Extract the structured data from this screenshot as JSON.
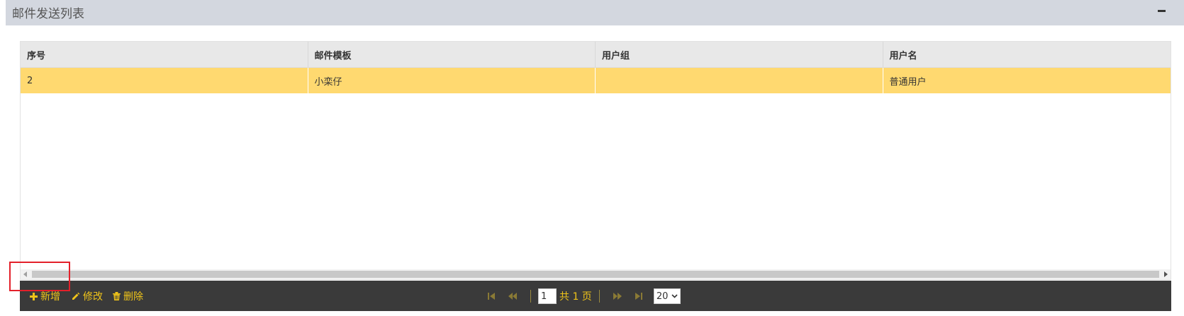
{
  "panel": {
    "title": "邮件发送列表"
  },
  "grid": {
    "columns": [
      "序号",
      "邮件模板",
      "用户组",
      "用户名"
    ],
    "rows": [
      [
        "2",
        "小栾仔",
        "",
        "普通用户"
      ]
    ],
    "selected_row_color": "#ffd970"
  },
  "toolbar": {
    "add_label": "新增",
    "edit_label": "修改",
    "delete_label": "删除",
    "accent_color": "#f0c419"
  },
  "pager": {
    "current_page": "1",
    "total_text": "共 1 页",
    "page_size": "20"
  }
}
